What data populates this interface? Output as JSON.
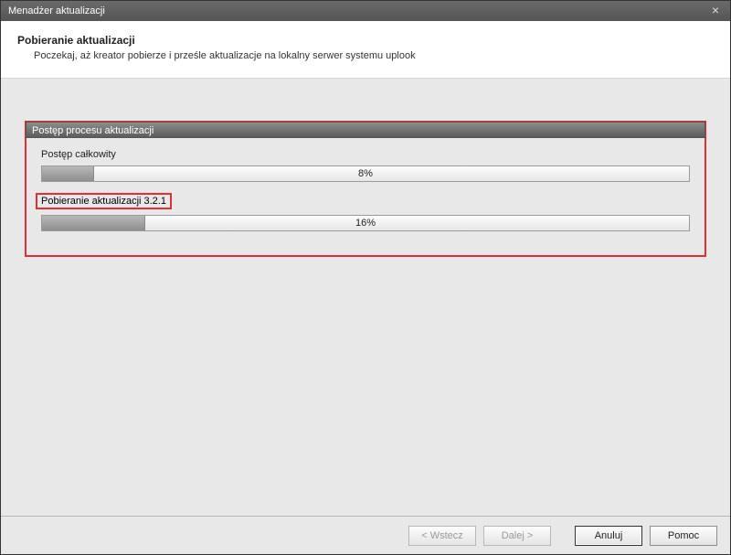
{
  "window": {
    "title": "Menadżer aktualizacji"
  },
  "header": {
    "title": "Pobieranie aktualizacji",
    "subtitle": "Poczekaj, aż kreator pobierze i prześle aktualizacje na lokalny serwer systemu uplook"
  },
  "progress_section": {
    "header": "Postęp procesu aktualizacji",
    "overall": {
      "label": "Postęp całkowity",
      "percent": 8,
      "percent_text": "8%"
    },
    "download": {
      "label": "Pobieranie aktualizacji 3.2.1",
      "percent": 16,
      "percent_text": "16%"
    }
  },
  "buttons": {
    "back": "< Wstecz",
    "next": "Dalej >",
    "cancel": "Anuluj",
    "help": "Pomoc"
  }
}
